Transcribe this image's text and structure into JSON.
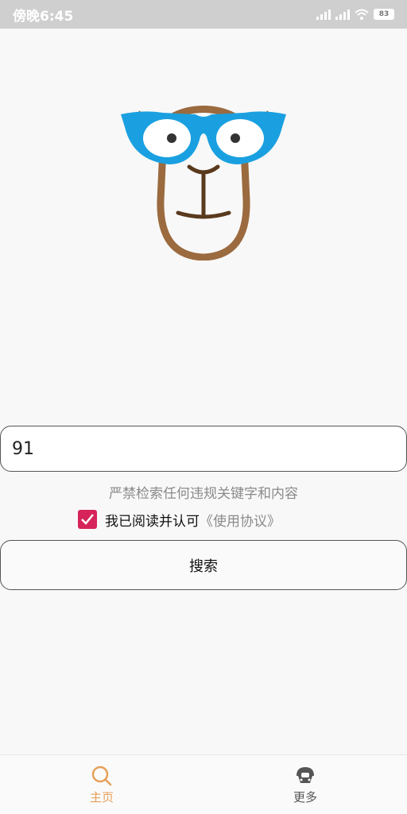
{
  "status_bar": {
    "time": "傍晚6:45",
    "battery": "83"
  },
  "search": {
    "value": "91",
    "placeholder": ""
  },
  "warning_text": "严禁检索任何违规关键字和内容",
  "agreement": {
    "checked": true,
    "text": "我已阅读并认可",
    "link": "《使用协议》"
  },
  "search_button_label": "搜索",
  "nav": {
    "home_label": "主页",
    "more_label": "更多"
  },
  "colors": {
    "accent": "#d6245a",
    "nav_active": "#e6a05a",
    "logo_blue": "#1aa0e0",
    "logo_brown": "#9b6a3f"
  }
}
